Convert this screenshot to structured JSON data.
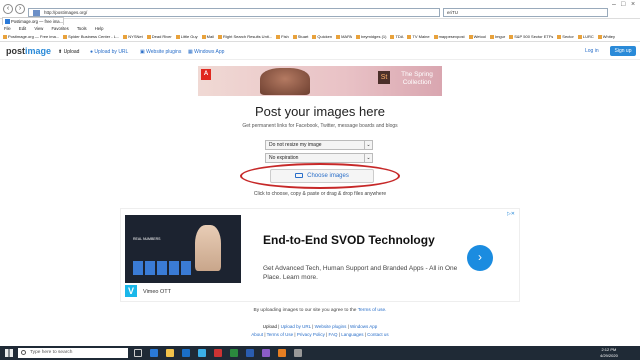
{
  "browser": {
    "address_url": "http://postimages.org/",
    "search_value": "eriTU",
    "tab_title": "Postimage.org — free ima...",
    "menu": [
      "File",
      "Edit",
      "View",
      "Favorites",
      "Tools",
      "Help"
    ],
    "bookmarks": [
      "Postimage.org — Free ima...",
      "Spider Business Center - L...",
      "NYSNet",
      "Dead River",
      "Little Guy",
      "Mail",
      "Right Search Results Unit...",
      "Fish",
      "Stuart",
      "Quicken",
      "MAPA",
      "beymidges (1)",
      "TDA",
      "TV Maine",
      "mappesexpost",
      "Wetool",
      "Imgur",
      "S&P 500 Sector ETFs",
      "Sector",
      "LURC",
      "Whitey"
    ]
  },
  "site": {
    "logo_a": "post",
    "logo_b": "image",
    "nav": {
      "upload": "Upload",
      "upload_url": "Upload by URL",
      "plugins": "Website plugins",
      "windows_app": "Windows App"
    },
    "login": "Log in",
    "signup": "Sign up"
  },
  "banner": {
    "adobe_label": "A",
    "st_label": "St",
    "promo": "The Spring Collection"
  },
  "main": {
    "headline": "Post your images here",
    "subline": "Get permanent links for Facebook, Twitter, message boards and blogs",
    "resize_value": "Do not resize my image",
    "expiration_value": "No expiration",
    "choose_label": "Choose images",
    "hint": "Click to choose, copy & paste or drag & drop files anywhere"
  },
  "ad": {
    "heading": "End-to-End SVOD Technology",
    "description": "Get Advanced Tech, Human Support and Branded Apps - All in One Place. Learn more.",
    "brand": "Vimeo OTT",
    "video_text": "REAL NUMBERS",
    "go_icon": "chevron-right-icon"
  },
  "footer": {
    "agree_prefix": "By uploading images to our site you agree to the",
    "agree_link": "Terms of use.",
    "links_row1": [
      "Upload",
      "Upload by URL",
      "Website plugins",
      "Windows App"
    ],
    "links_row2": [
      "About",
      "Terms of Use",
      "Privacy Policy",
      "FAQ",
      "Languages",
      "Contact us"
    ]
  },
  "taskbar": {
    "search_placeholder": "Type here to search",
    "time": "2:12 PM",
    "date": "4/29/2020"
  },
  "colors": {
    "accent": "#2a8ad8",
    "highlight_ellipse": "#c62828",
    "taskbar": "#1f2a36"
  }
}
